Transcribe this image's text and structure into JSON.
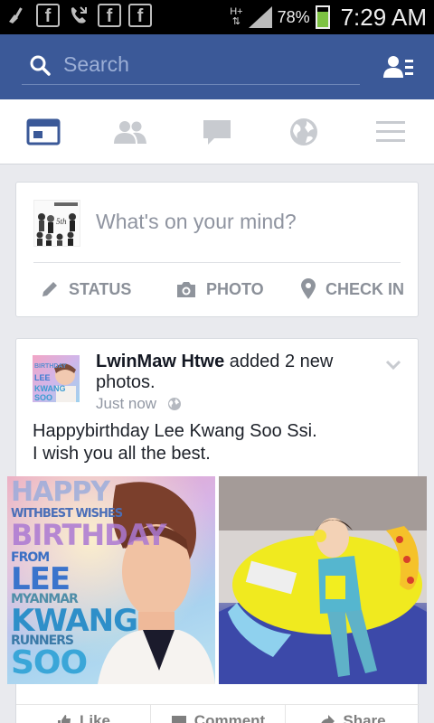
{
  "status_bar": {
    "network": "H+",
    "battery": "78%",
    "time": "7:29 AM",
    "notification_icons": [
      "cleaner-icon",
      "facebook-icon",
      "missed-call-icon",
      "facebook-icon",
      "facebook-icon"
    ]
  },
  "header": {
    "search_placeholder": "Search",
    "friend_requests_icon": "friend-requests-icon"
  },
  "tabs": [
    {
      "name": "news-feed",
      "icon": "news-feed-icon",
      "active": true
    },
    {
      "name": "friends",
      "icon": "friends-icon",
      "active": false
    },
    {
      "name": "messages",
      "icon": "chat-bubble-icon",
      "active": false
    },
    {
      "name": "notifications",
      "icon": "globe-icon",
      "active": false
    },
    {
      "name": "more",
      "icon": "menu-icon",
      "active": false
    }
  ],
  "composer": {
    "prompt": "What's on your mind?",
    "status_label": "STATUS",
    "photo_label": "PHOTO",
    "checkin_label": "CHECK IN"
  },
  "post": {
    "author": "LwinMaw Htwe",
    "action_line1": " added 2 new",
    "action_line2": "photos.",
    "time": "Just now",
    "text_line1": "Happybirthday Lee Kwang Soo Ssi.",
    "text_line2": "I wish you all the best.",
    "photo1_lines": [
      "HAPPY",
      "WITHBEST WISHES",
      "BIRTHDAY",
      "FROM",
      "LEE",
      "MYANMAR",
      "KWANG",
      "RUNNERS",
      "SOO"
    ],
    "like_label": "Like",
    "comment_label": "Comment",
    "share_label": "Share"
  },
  "colors": {
    "brand_blue": "#3b5998",
    "tab_active": "#3b5998",
    "tab_inactive": "#c8cbd0",
    "battery_green": "#7dc242"
  }
}
